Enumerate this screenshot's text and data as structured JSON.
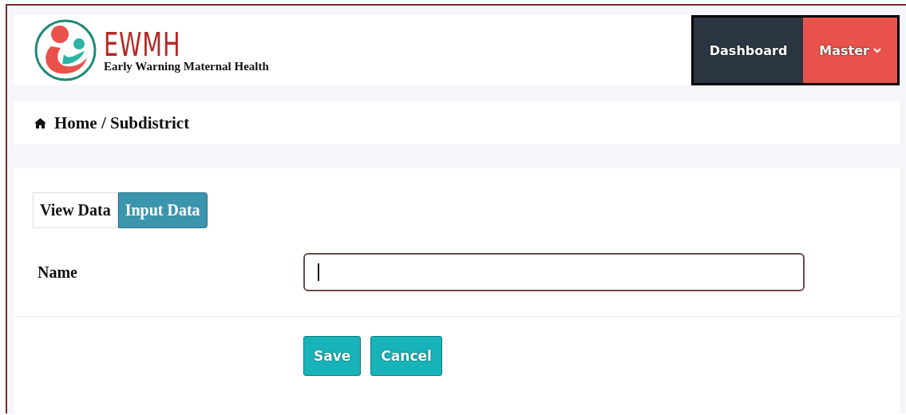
{
  "brand": {
    "name": "EWMH",
    "tagline": "Early Warning Maternal Health"
  },
  "nav": [
    {
      "label": "Dashboard",
      "color": "#2b3542",
      "dropdown": false
    },
    {
      "label": "Master",
      "color": "#e8524a",
      "dropdown": true
    }
  ],
  "breadcrumb": "Home / Subdistrict",
  "tabs": [
    {
      "label": "View Data",
      "selected": false
    },
    {
      "label": "Input Data",
      "selected": true
    }
  ],
  "form": {
    "label": "Name",
    "focused": true
  },
  "buttons": [
    "Save",
    "Cancel"
  ]
}
